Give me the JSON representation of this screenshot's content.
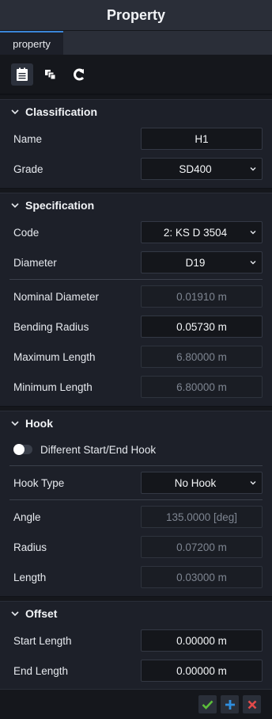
{
  "window": {
    "title": "Property"
  },
  "tabs": [
    {
      "label": "property",
      "active": true
    }
  ],
  "toolbar": {
    "icons": [
      "document-icon",
      "copy-icon",
      "refresh-icon"
    ]
  },
  "sections": {
    "classification": {
      "title": "Classification",
      "name": {
        "label": "Name",
        "value": "H1"
      },
      "grade": {
        "label": "Grade",
        "value": "SD400"
      }
    },
    "specification": {
      "title": "Specification",
      "code": {
        "label": "Code",
        "value": "2: KS D 3504"
      },
      "diameter": {
        "label": "Diameter",
        "value": "D19"
      },
      "nominal_diameter": {
        "label": "Nominal Diameter",
        "value": "0.01910 m"
      },
      "bending_radius": {
        "label": "Bending Radius",
        "value": "0.05730 m"
      },
      "maximum_length": {
        "label": "Maximum Length",
        "value": "6.80000 m"
      },
      "minimum_length": {
        "label": "Minimum Length",
        "value": "6.80000 m"
      }
    },
    "hook": {
      "title": "Hook",
      "different_start_end": {
        "label": "Different Start/End Hook",
        "on": false
      },
      "hook_type": {
        "label": "Hook Type",
        "value": "No Hook"
      },
      "angle": {
        "label": "Angle",
        "value": "135.0000 [deg]"
      },
      "radius": {
        "label": "Radius",
        "value": "0.07200 m"
      },
      "length": {
        "label": "Length",
        "value": "0.03000 m"
      }
    },
    "offset": {
      "title": "Offset",
      "start_length": {
        "label": "Start Length",
        "value": "0.00000 m"
      },
      "end_length": {
        "label": "End Length",
        "value": "0.00000 m"
      }
    }
  },
  "footer": {
    "buttons": [
      "confirm-icon",
      "add-icon",
      "cancel-icon"
    ]
  },
  "colors": {
    "accent": "#3a86d8",
    "confirm": "#5bbf3a",
    "add": "#2f8fe0",
    "cancel": "#e24a4a",
    "panel": "#1d2029"
  }
}
